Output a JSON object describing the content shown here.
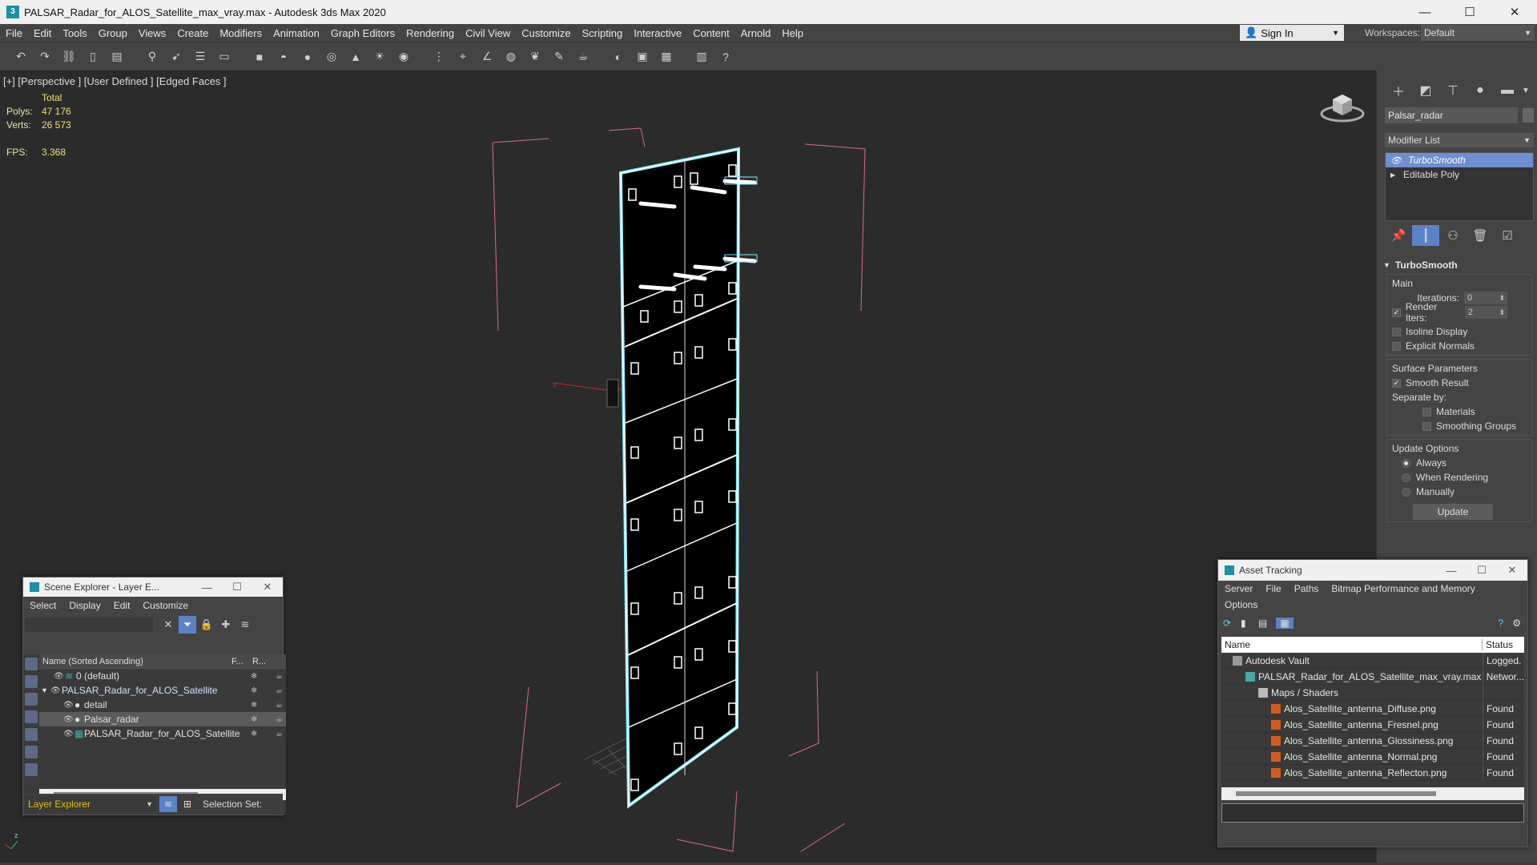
{
  "window": {
    "title": "PALSAR_Radar_for_ALOS_Satellite_max_vray.max - Autodesk 3ds Max 2020",
    "minimize": "—",
    "maximize": "☐",
    "close": "✕"
  },
  "menu": [
    "File",
    "Edit",
    "Tools",
    "Group",
    "Views",
    "Create",
    "Modifiers",
    "Animation",
    "Graph Editors",
    "Rendering",
    "Civil View",
    "Customize",
    "Scripting",
    "Interactive",
    "Content",
    "Arnold",
    "Help"
  ],
  "account": {
    "signin": "Sign In",
    "workspaces_label": "Workspaces:",
    "workspace": "Default"
  },
  "viewport": {
    "label": "[+] [Perspective ] [User Defined ] [Edged Faces ]",
    "stats_header": "Total",
    "polys_label": "Polys:",
    "polys": "47 176",
    "verts_label": "Verts:",
    "verts": "26 573",
    "fps_label": "FPS:",
    "fps": "3.368"
  },
  "command_panel": {
    "object_name": "Palsar_radar",
    "modifier_list": "Modifier List",
    "stack": [
      {
        "label": "TurboSmooth",
        "selected": true
      },
      {
        "label": "Editable Poly",
        "selected": false
      }
    ],
    "rollout_title": "TurboSmooth",
    "main_label": "Main",
    "iterations_label": "Iterations:",
    "iterations": "0",
    "render_iters_label": "Render Iters:",
    "render_iters": "2",
    "isoline": "Isoline Display",
    "explicit_normals": "Explicit Normals",
    "surface_params": "Surface Parameters",
    "smooth_result": "Smooth Result",
    "separate_by": "Separate by:",
    "materials": "Materials",
    "smoothing_groups": "Smoothing Groups",
    "update_options": "Update Options",
    "always": "Always",
    "when_rendering": "When Rendering",
    "manually": "Manually",
    "update_btn": "Update"
  },
  "scene_explorer": {
    "title": "Scene Explorer - Layer E...",
    "menu": [
      "Select",
      "Display",
      "Edit",
      "Customize"
    ],
    "col_name": "Name (Sorted Ascending)",
    "col_f": "F...",
    "col_r": "R...",
    "rows": [
      {
        "label": "0 (default)",
        "indent": 1
      },
      {
        "label": "PALSAR_Radar_for_ALOS_Satellite",
        "indent": 0
      },
      {
        "label": "detail",
        "indent": 2
      },
      {
        "label": "Palsar_radar",
        "indent": 2
      },
      {
        "label": "PALSAR_Radar_for_ALOS_Satellite",
        "indent": 2
      }
    ],
    "layer_explorer": "Layer Explorer",
    "selection_set": "Selection Set:"
  },
  "asset_tracking": {
    "title": "Asset Tracking",
    "menu": [
      "Server",
      "File",
      "Paths",
      "Bitmap Performance and Memory"
    ],
    "menu2": "Options",
    "col_name": "Name",
    "col_status": "Status",
    "rows": [
      {
        "name": "Autodesk Vault",
        "status": "Logged.",
        "indent": 1
      },
      {
        "name": "PALSAR_Radar_for_ALOS_Satellite_max_vray.max",
        "status": "Networ...",
        "indent": 2
      },
      {
        "name": "Maps / Shaders",
        "status": "",
        "indent": 3
      },
      {
        "name": "Alos_Satellite_antenna_Diffuse.png",
        "status": "Found",
        "indent": 4
      },
      {
        "name": "Alos_Satellite_antenna_Fresnel.png",
        "status": "Found",
        "indent": 4
      },
      {
        "name": "Alos_Satellite_antenna_Glossiness.png",
        "status": "Found",
        "indent": 4
      },
      {
        "name": "Alos_Satellite_antenna_Normal.png",
        "status": "Found",
        "indent": 4
      },
      {
        "name": "Alos_Satellite_antenna_Reflecton.png",
        "status": "Found",
        "indent": 4
      }
    ]
  },
  "colors": {
    "accent": "#5a82c8",
    "selection": "#6e8fd0",
    "stats": "#f0e070",
    "bbox": "#d86a8a"
  }
}
